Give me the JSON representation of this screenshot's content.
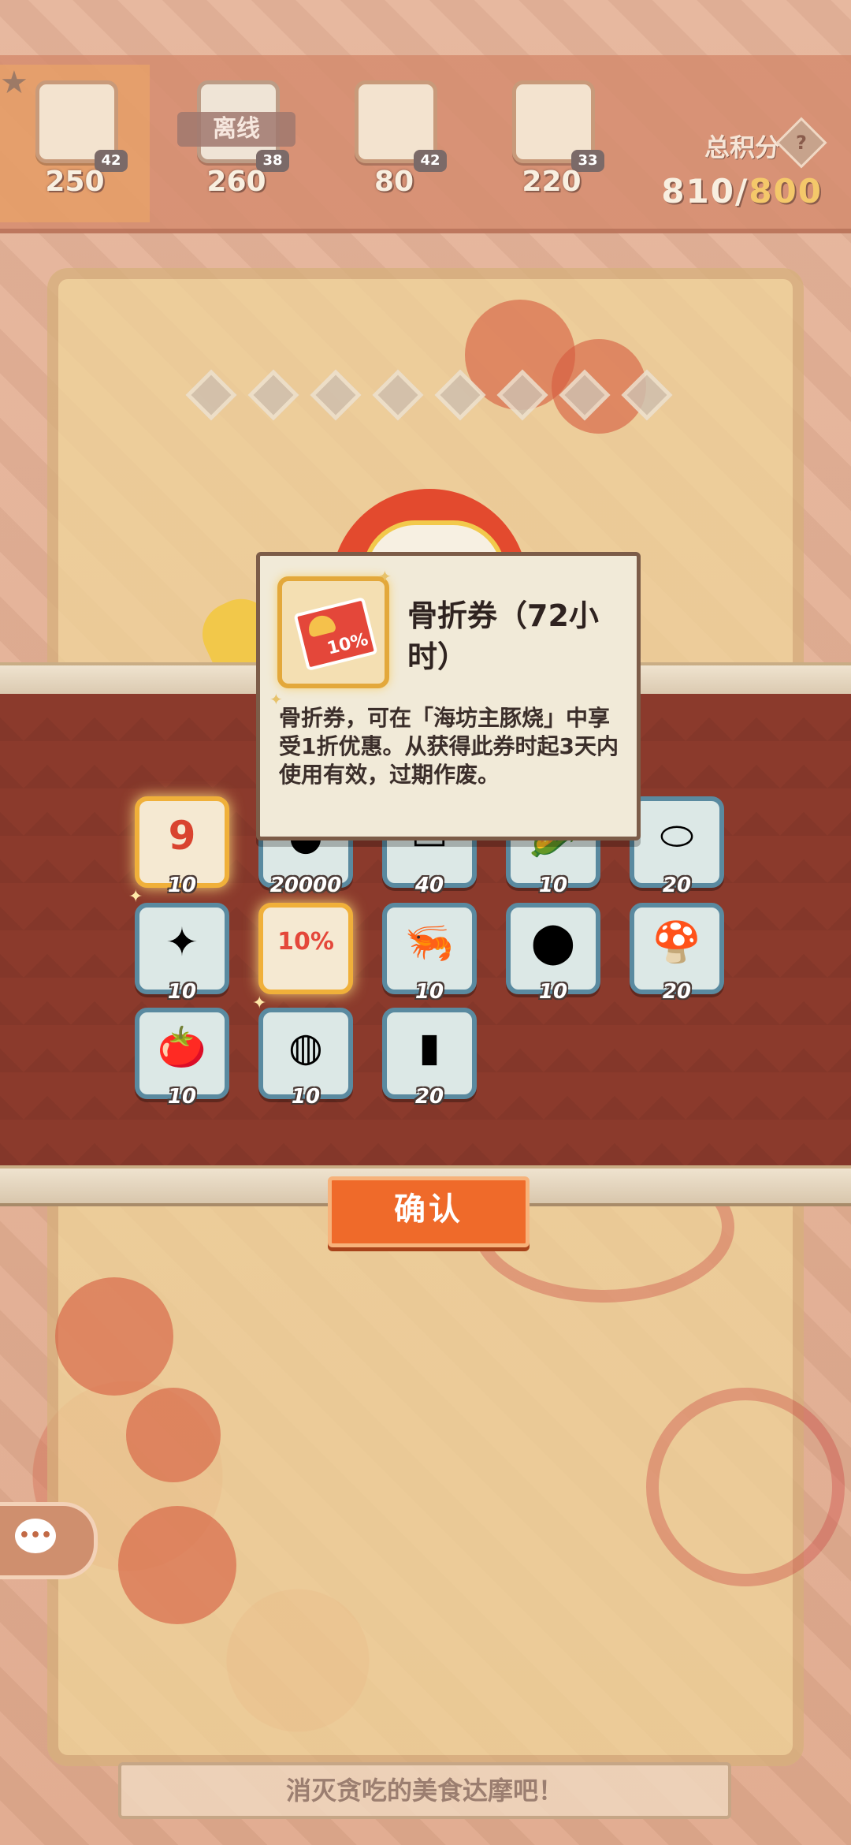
{
  "players": [
    {
      "score": "250",
      "level": "42",
      "offline": false,
      "me": true
    },
    {
      "score": "260",
      "level": "38",
      "offline": true,
      "status": "离线"
    },
    {
      "score": "80",
      "level": "42",
      "offline": false
    },
    {
      "score": "220",
      "level": "33",
      "offline": false
    }
  ],
  "total": {
    "label": "总积分",
    "current": "810/",
    "target": "800"
  },
  "progress": {
    "diamonds_total": 8
  },
  "tooltip": {
    "title": "骨折券（72小时）",
    "description": "骨折券，可在「海坊主豚烧」中享受1折优惠。从获得此券时起3天内使用有效，过期作废。",
    "icon": "discount-ticket-icon",
    "icon_text": "10%"
  },
  "rewards": [
    {
      "icon": "nine-coin-icon",
      "glyph": "9",
      "qty": "10",
      "golden": true
    },
    {
      "icon": "gold-coin-icon",
      "glyph": "●",
      "qty": "20000",
      "golden": false
    },
    {
      "icon": "rice-cake-icon",
      "glyph": "▭",
      "qty": "40",
      "golden": false
    },
    {
      "icon": "corn-icon",
      "glyph": "🌽",
      "qty": "10",
      "golden": false
    },
    {
      "icon": "egg-icon",
      "glyph": "⬭",
      "qty": "20",
      "golden": false
    },
    {
      "icon": "squid-icon",
      "glyph": "✦",
      "qty": "10",
      "golden": false
    },
    {
      "icon": "discount-ticket-icon",
      "glyph": "10%",
      "qty": "",
      "golden": true
    },
    {
      "icon": "shrimp-icon",
      "glyph": "🦐",
      "qty": "10",
      "golden": false
    },
    {
      "icon": "meat-patty-icon",
      "glyph": "⬤",
      "qty": "10",
      "golden": false
    },
    {
      "icon": "mushroom-icon",
      "glyph": "🍄",
      "qty": "20",
      "golden": false
    },
    {
      "icon": "tomato-icon",
      "glyph": "🍅",
      "qty": "10",
      "golden": false
    },
    {
      "icon": "cabbage-bowl-icon",
      "glyph": "◍",
      "qty": "10",
      "golden": false
    },
    {
      "icon": "salmon-icon",
      "glyph": "▮",
      "qty": "20",
      "golden": false
    }
  ],
  "confirm_label": "确认",
  "hint": "消灭贪吃的美食达摩吧！",
  "colors": {
    "band": "#8b3a2c",
    "button": "#ef6a2a",
    "gold_score": "#f4c86a"
  }
}
